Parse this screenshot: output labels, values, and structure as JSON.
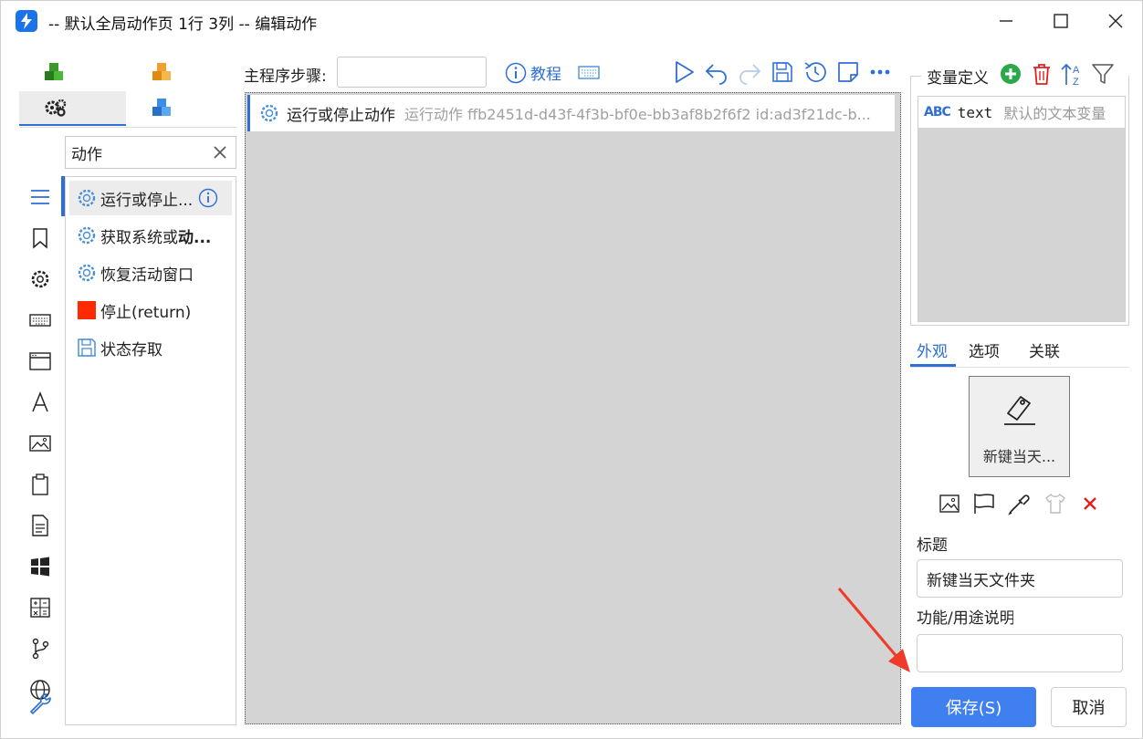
{
  "window": {
    "title": "-- 默认全局动作页 1行 3列 -- 编辑动作",
    "app_icon": "lightning-app-icon",
    "controls": [
      "minimize-icon",
      "maximize-icon",
      "close-icon"
    ]
  },
  "left_panel": {
    "categories": [
      {
        "icon": "green-cubes-icon"
      },
      {
        "icon": "orange-cubes-icon"
      },
      {
        "icon": "gears-icon",
        "selected": true
      },
      {
        "icon": "blue-cubes-icon"
      }
    ],
    "search": {
      "value": "动作"
    },
    "side_icons": [
      "list-icon",
      "bookmark-icon",
      "gear-icon",
      "keyboard-icon",
      "window-icon",
      "font-icon",
      "image-icon",
      "clipboard-icon",
      "document-icon",
      "windows-icon",
      "calculator-icon",
      "branch-icon",
      "globe-icon",
      "wrench-icon"
    ],
    "actions": [
      {
        "label": "运行或停止...",
        "icon": "gear-icon",
        "selected": true,
        "has_info": true
      },
      {
        "label": "获取系统或",
        "label_bold": "动...",
        "icon": "gear-icon"
      },
      {
        "label": "恢复活动窗口",
        "icon": "gear-icon"
      },
      {
        "label": "停止(return)",
        "icon": "stop-square-icon"
      },
      {
        "label": "状态存取",
        "icon": "save-icon"
      }
    ]
  },
  "center": {
    "step_label": "主程序步骤:",
    "step_value": "",
    "tutorial_label": "教程",
    "toolbar": [
      "run-icon",
      "undo-icon",
      "redo-icon",
      "save-icon",
      "history-icon",
      "note-icon",
      "more-icon"
    ],
    "steps": [
      {
        "name": "运行或停止动作",
        "detail": "运行动作 ffb2451d-d43f-4f3b-bf0e-bb3af8b2f6f2 id:ad3f21dc-b..."
      }
    ]
  },
  "right_panel": {
    "variables_label": "变量定义",
    "variables": [
      {
        "type": "ABC",
        "name": "text",
        "desc": "默认的文本变量"
      }
    ],
    "tabs": [
      "外观",
      "选项",
      "关联"
    ],
    "active_tab": 0,
    "preview_caption": "新键当天...",
    "title_label": "标题",
    "title_value": "新键当天文件夹",
    "desc_label": "功能/用途说明",
    "desc_value": "",
    "save_button": "保存(S)",
    "cancel_button": "取消"
  },
  "colors": {
    "accent": "#2f6fd4",
    "primary_button": "#3f7ff0",
    "delete": "#e02020",
    "add": "#2aa84a",
    "canvas": "#d4d4d4"
  }
}
